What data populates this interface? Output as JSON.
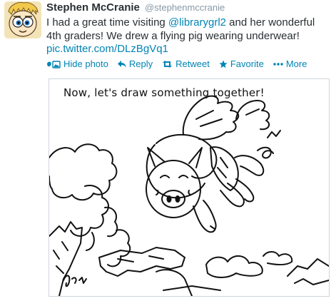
{
  "tweet": {
    "author_name": "Stephen McCranie",
    "author_handle": "@stephenmccranie",
    "text_before": "I had a great time visiting ",
    "mention": "@librarygrl2",
    "text_after": " and her wonderful 4th graders! We drew a flying pig wearing underwear!",
    "link": "pic.twitter.com/DLzBgVq1"
  },
  "actions": {
    "hide_photo": "Hide photo",
    "reply": "Reply",
    "retweet": "Retweet",
    "favorite": "Favorite",
    "more": "More"
  },
  "photo": {
    "caption": "Now, let's draw something together!"
  },
  "colors": {
    "link": "#0084b4",
    "text": "#292f33",
    "muted": "#8899a6"
  }
}
